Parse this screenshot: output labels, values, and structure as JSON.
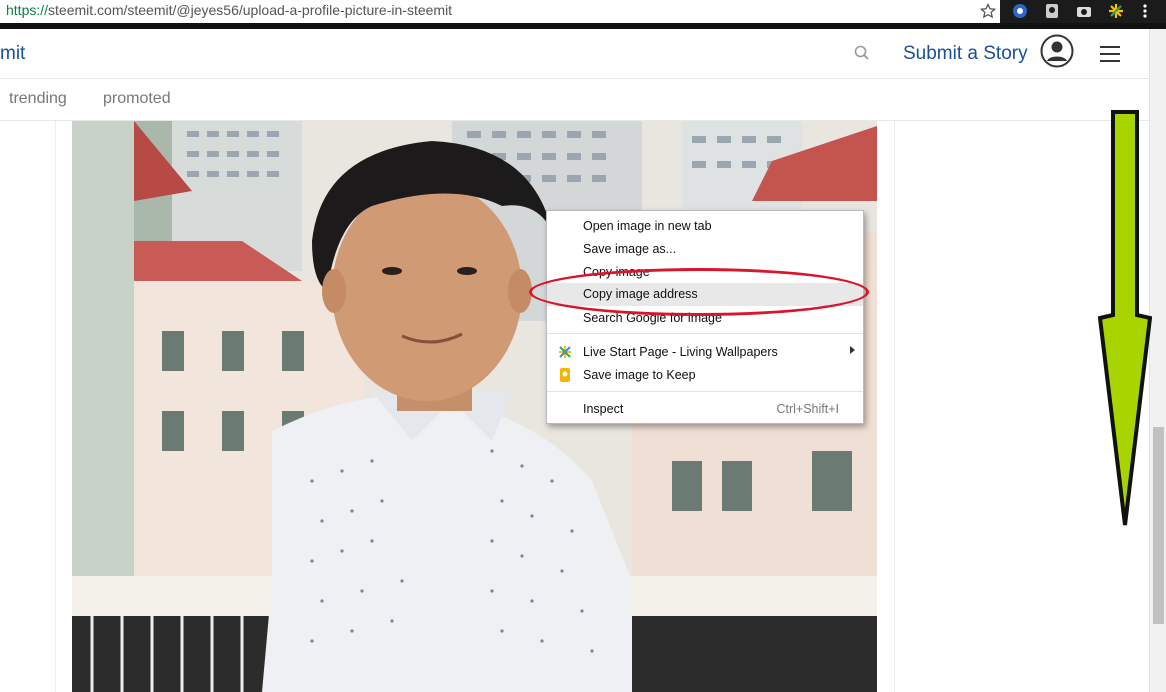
{
  "browser": {
    "url_scheme": "https://",
    "url_rest": "steemit.com/steemit/@jeyes56/upload-a-profile-picture-in-steemit"
  },
  "header": {
    "logo": "mit",
    "submit_label": "Submit a Story"
  },
  "subnav": {
    "tabs": [
      "trending",
      "promoted"
    ]
  },
  "context_menu": {
    "items": [
      {
        "label": "Open image in new tab"
      },
      {
        "label": "Save image as..."
      },
      {
        "label": "Copy image"
      },
      {
        "label": "Copy image address"
      },
      {
        "label": "Search Google for image"
      },
      {
        "label": "Live Start Page - Living Wallpapers"
      },
      {
        "label": "Save image to Keep"
      },
      {
        "label": "Inspect",
        "shortcut": "Ctrl+Shift+I"
      }
    ],
    "highlighted": "Copy image address"
  },
  "colors": {
    "link_blue": "#1a5099",
    "annotation_red": "#d8152b",
    "arrow_green": "#a8d400"
  }
}
